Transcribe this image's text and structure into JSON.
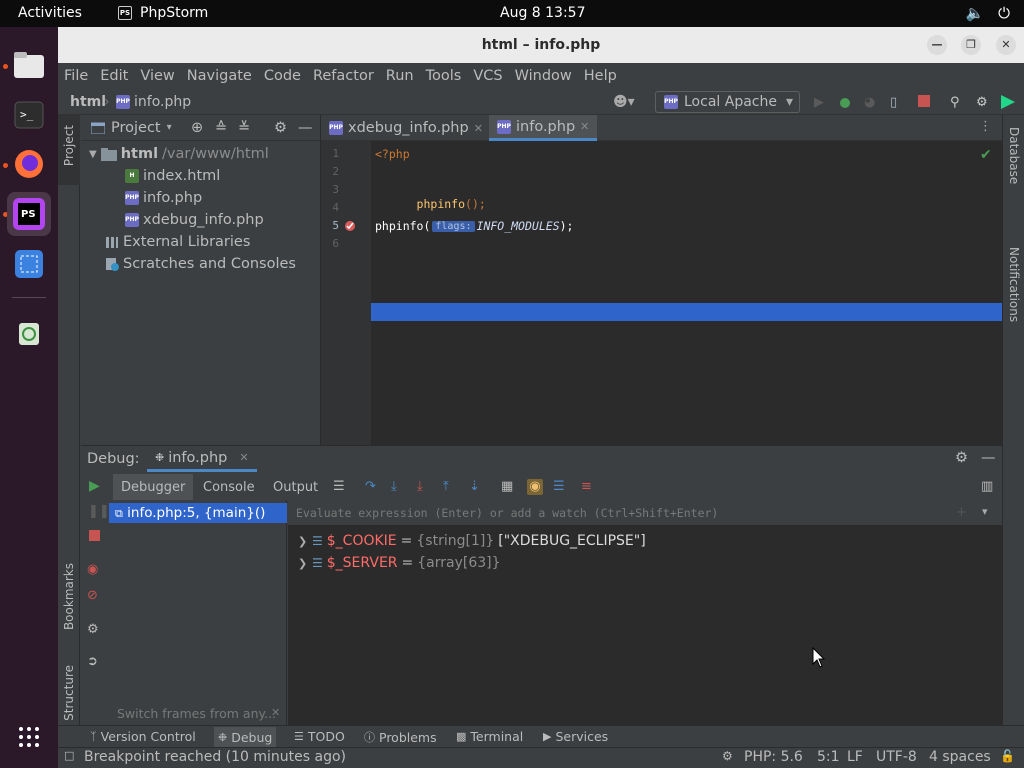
{
  "top": {
    "activities": "Activities",
    "app_name": "PhpStorm",
    "app_icon_text": "PS",
    "datetime": "Aug 8  13:57"
  },
  "window": {
    "title": "html – info.php"
  },
  "menu": [
    "File",
    "Edit",
    "View",
    "Navigate",
    "Code",
    "Refactor",
    "Run",
    "Tools",
    "VCS",
    "Window",
    "Help"
  ],
  "nav": {
    "root": "html",
    "file": "info.php",
    "run_config": "Local Apache"
  },
  "project": {
    "title": "Project",
    "root_name": "html",
    "root_path": "/var/www/html",
    "files": [
      "index.html",
      "info.php",
      "xdebug_info.php"
    ],
    "external": "External Libraries",
    "scratches": "Scratches and Consoles",
    "icon_html": "H",
    "icon_php": "PHP"
  },
  "editor": {
    "tabs": [
      {
        "label": "xdebug_info.php"
      },
      {
        "label": "info.php"
      }
    ],
    "lines": [
      "1",
      "2",
      "3",
      "4",
      "5",
      "6"
    ],
    "code": {
      "l1": "<?php",
      "l3_fn": "phpinfo",
      "l3_rest": "();",
      "l5_fn": "phpinfo(",
      "l5_hint": "flags:",
      "l5_arg": "INFO_MODULES",
      "l5_end": ");"
    }
  },
  "side": {
    "project": "Project",
    "bookmarks": "Bookmarks",
    "structure": "Structure",
    "database": "Database",
    "notifications": "Notifications"
  },
  "debug": {
    "label": "Debug:",
    "session": "info.php",
    "tabs": [
      "Debugger",
      "Console",
      "Output"
    ],
    "frame": "info.php:5, {main}()",
    "frame_hint": "Switch frames from any...",
    "eval_placeholder": "Evaluate expression (Enter) or add a watch (Ctrl+Shift+Enter)",
    "vars": [
      {
        "name": "$_COOKIE",
        "eq": "=",
        "type": "{string[1]}",
        "value": "[\"XDEBUG_ECLIPSE\"]"
      },
      {
        "name": "$_SERVER",
        "eq": "=",
        "type": "{array[63]}",
        "value": ""
      }
    ]
  },
  "bottom_tabs": [
    "Version Control",
    "Debug",
    "TODO",
    "Problems",
    "Terminal",
    "Services"
  ],
  "status": {
    "message": "Breakpoint reached (10 minutes ago)",
    "php": "PHP: 5.6",
    "pos": "5:1",
    "eol": "LF",
    "encoding": "UTF-8",
    "indent": "4 spaces"
  },
  "colors": {
    "accent": "#2f65ca",
    "php_keyword": "#cc7832",
    "var_name": "#ff6b68",
    "breakpoint": "#db5c5c",
    "ps_brand": "#8a3ffc"
  }
}
